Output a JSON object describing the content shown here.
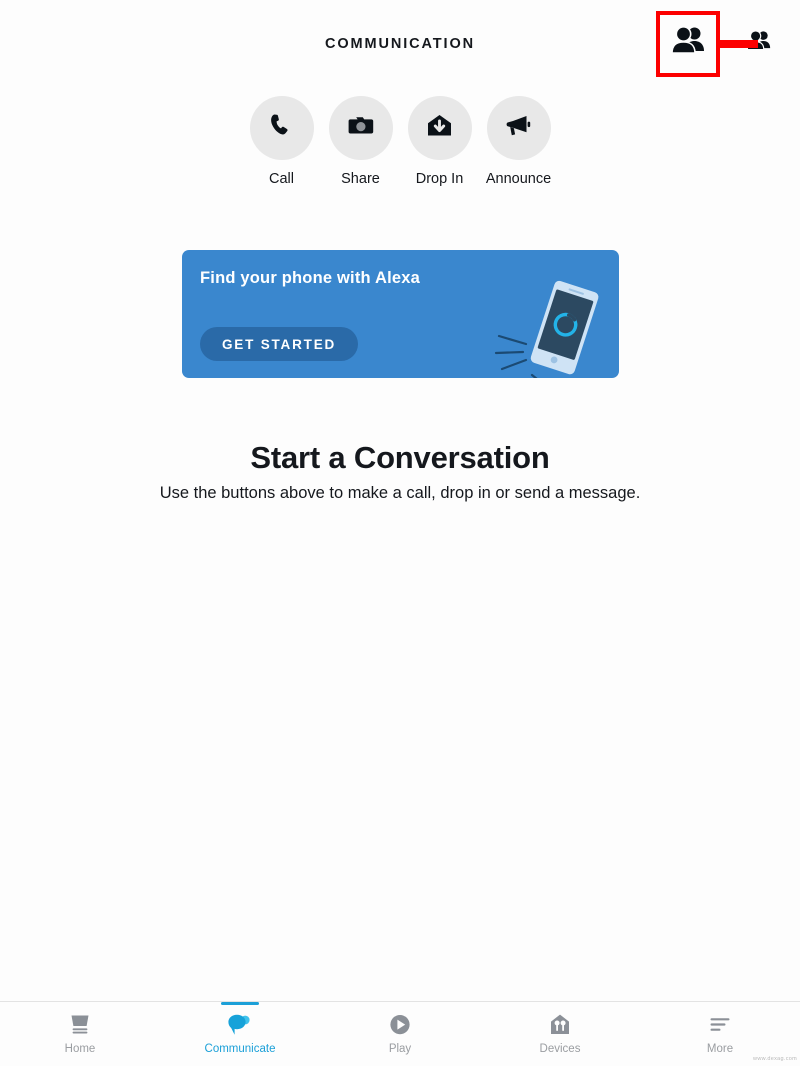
{
  "header": {
    "title": "COMMUNICATION",
    "contacts_icon": "contacts-people-icon",
    "contacts_icon_secondary": "contacts-people-icon-small"
  },
  "annotation": {
    "box_color": "#fc0000",
    "arrow_color": "#fc0000",
    "target": "contacts-button"
  },
  "actions": [
    {
      "label": "Call",
      "icon": "phone-icon"
    },
    {
      "label": "Share",
      "icon": "camera-icon"
    },
    {
      "label": "Drop In",
      "icon": "drop-in-house-arrow-icon"
    },
    {
      "label": "Announce",
      "icon": "megaphone-icon"
    }
  ],
  "promo": {
    "title": "Find your phone with Alexa",
    "cta_label": "GET STARTED",
    "bg_color": "#3a87ce",
    "cta_color": "#2a6aa8",
    "art": "tilted-smartphone-with-alexa-ring-illustration"
  },
  "empty_state": {
    "title": "Start a Conversation",
    "subtitle": "Use the buttons above to make a call, drop in or send a message."
  },
  "bottom_nav": {
    "active_color": "#1ca0d8",
    "inactive_color": "#9a9da1",
    "items": [
      {
        "label": "Home",
        "icon": "echo-device-icon",
        "active": false
      },
      {
        "label": "Communicate",
        "icon": "speech-bubbles-icon",
        "active": true
      },
      {
        "label": "Play",
        "icon": "play-circle-icon",
        "active": false
      },
      {
        "label": "Devices",
        "icon": "house-devices-icon",
        "active": false
      },
      {
        "label": "More",
        "icon": "hamburger-menu-icon",
        "active": false
      }
    ]
  },
  "watermark": "www.dexag.com"
}
